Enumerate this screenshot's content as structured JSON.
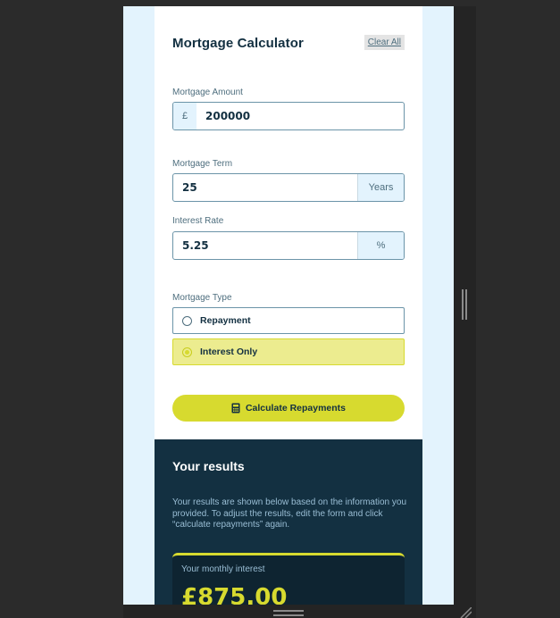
{
  "calculator": {
    "title": "Mortgage Calculator",
    "clear_all": "Clear All"
  },
  "amount": {
    "label": "Mortgage Amount",
    "prefix": "£",
    "value": "200000"
  },
  "term": {
    "label": "Mortgage Term",
    "value": "25",
    "suffix": "Years"
  },
  "rate": {
    "label": "Interest Rate",
    "value": "5.25",
    "suffix": "%"
  },
  "type": {
    "label": "Mortgage Type",
    "options": [
      {
        "label": "Repayment",
        "selected": false
      },
      {
        "label": "Interest Only",
        "selected": true
      }
    ]
  },
  "calculate": {
    "label": "Calculate Repayments",
    "icon": "calculator-icon"
  },
  "results": {
    "title": "Your results",
    "description": "Your results are shown below based on the information you provided. To adjust the results, edit the form and click “calculate repayments” again.",
    "monthly_label": "Your monthly interest",
    "monthly_value": "£875.00"
  },
  "colors": {
    "accent": "#d7da2f",
    "dark": "#133041",
    "light_bg": "#e3f3fd"
  }
}
